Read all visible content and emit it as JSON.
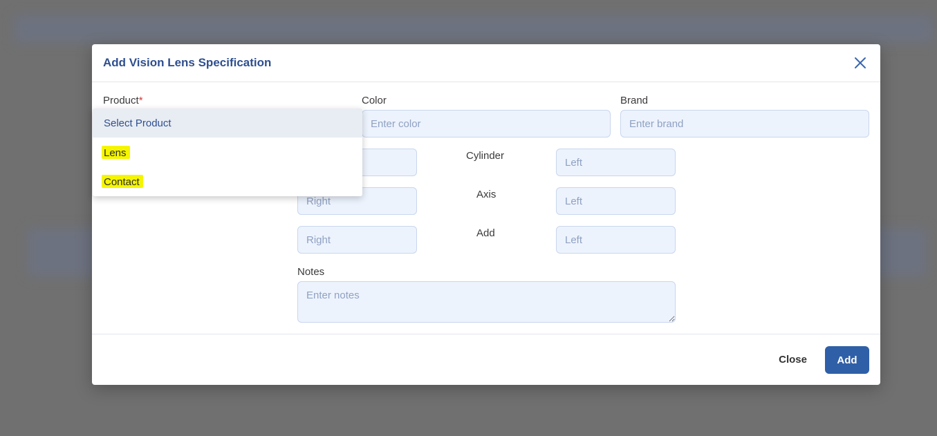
{
  "modal": {
    "title": "Add Vision Lens Specification"
  },
  "fields": {
    "product_label": "Product",
    "product_required_mark": "*",
    "color_label": "Color",
    "color_placeholder": "Enter color",
    "brand_label": "Brand",
    "brand_placeholder": "Enter brand",
    "cylinder_label": "Cylinder",
    "axis_label": "Axis",
    "add_label": "Add",
    "right_placeholder": "Right",
    "left_placeholder": "Left",
    "notes_label": "Notes",
    "notes_placeholder": "Enter notes"
  },
  "dropdown": {
    "options": [
      "Select Product",
      "Lens",
      "Contact"
    ],
    "selected": "Select Product",
    "highlight_color": "#f5f500"
  },
  "footer": {
    "close_label": "Close",
    "add_label": "Add"
  },
  "colors": {
    "accent": "#2f5fa7",
    "title": "#2f4f8f",
    "input_bg": "#edf3fd"
  }
}
